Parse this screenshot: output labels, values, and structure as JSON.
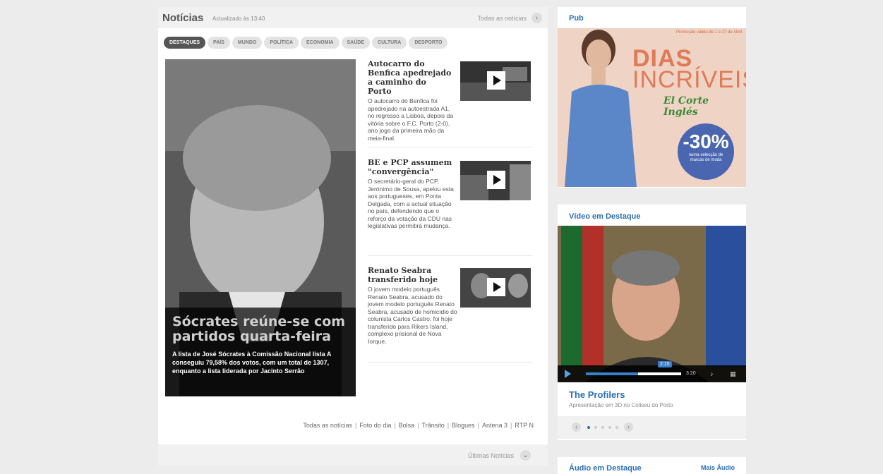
{
  "news": {
    "title": "Notícias",
    "updated": "Actualizado às 13:40",
    "all_news": "Todas as notícias",
    "tabs": [
      "Destaques",
      "País",
      "Mundo",
      "Política",
      "Economia",
      "Saúde",
      "Cultura",
      "Desporto"
    ],
    "feature": {
      "headline": "Sócrates reúne-se com partidos quarta-feira",
      "text": "A lista de José Sócrates à Comissão Nacional lista A conseguiu 79,58% dos votos, com um total de 1307, enquanto a lista liderada por Jacinto Serrão"
    },
    "stories": [
      {
        "title": "Autocarro do Benfica apedrejado a caminho do Porto",
        "text": "O autocarro do Benfica foi apedrejado na autoestrada A1, no regresso a Lisboa, depois da vitória sobre o F.C. Porto (2-0), ano jogo da primeira mão da meia-final."
      },
      {
        "title": "BE e PCP assumem \"convergência\"",
        "text": "O secretário-geral do PCP, Jerónimo de Sousa, apelou esta aos portugueses, em Ponta Delgada, com a actual situação no país, defendendo que o reforço da votação da CDU nas legislativas permitirá mudança."
      },
      {
        "title": "Renato Seabra transferido hoje",
        "text": "O jovem modelo português Renato Seabra, acusado do jovem modelo português Renato Seabra, acusado de homicídio do colunista Carlos Castro, foi hoje transferido para Rikers Island, complexo prisional de Nova Iorque."
      }
    ],
    "footer_links": [
      "Todas as notícias",
      "Foto do dia",
      "Bolsa",
      "Trânsito",
      "Blogues",
      "Antena 3",
      "RTP N"
    ],
    "latest": "Últimas Notícias"
  },
  "pub": {
    "title": "Pub",
    "small": "Promoção válida de 1 a 17 de Abril",
    "title1": "DIAS",
    "title2": "INCRÍVEIS",
    "brand": "El Corte Inglés",
    "badge_pct": "-30%",
    "badge_sub": "numa selecção de marcas de moda"
  },
  "video": {
    "title": "Vídeo em Destaque",
    "clip_title": "The Profilers",
    "clip_sub": "Apresentação em 3D no Coliseu do Porto",
    "time_tip": "2:15",
    "duration": "3:20",
    "progress": 0.55
  },
  "audio": {
    "title": "Áudio em Destaque",
    "more": "Mais Áudio"
  },
  "colors": {
    "accent": "#2a6fb6",
    "panel": "#f1f1f1"
  }
}
